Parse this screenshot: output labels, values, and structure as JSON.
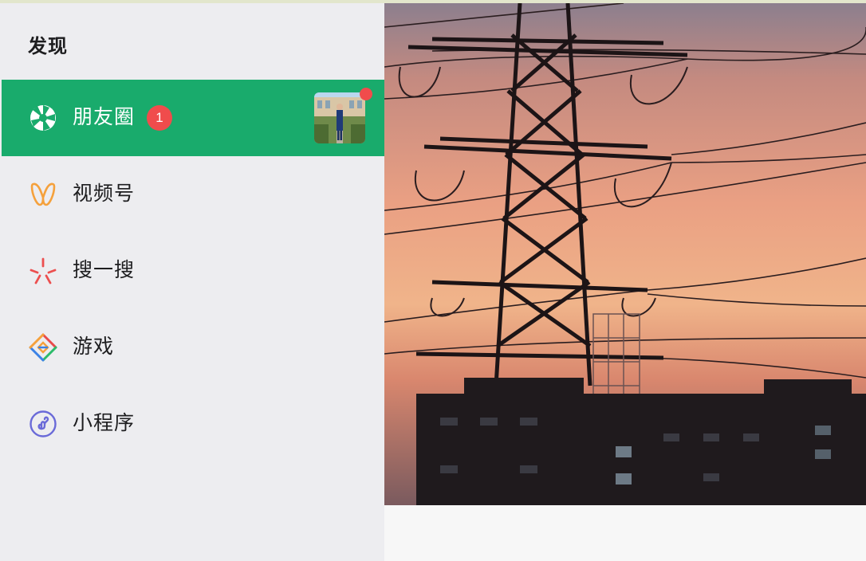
{
  "sidebar": {
    "title": "发现",
    "items": [
      {
        "label": "朋友圈",
        "icon": "moments-shutter-icon",
        "active": true,
        "badge": "1"
      },
      {
        "label": "视频号",
        "icon": "channels-icon"
      },
      {
        "label": "搜一搜",
        "icon": "search-sparkle-icon"
      },
      {
        "label": "游戏",
        "icon": "games-diamond-icon"
      },
      {
        "label": "小程序",
        "icon": "mini-program-icon"
      }
    ]
  },
  "colors": {
    "active_bg": "#19ab6c",
    "badge": "#f04c4c",
    "sidebar_bg": "#ededf0",
    "channels": "#f5a13c",
    "search": "#ec4f4f",
    "mini_program": "#6a6ad8"
  }
}
